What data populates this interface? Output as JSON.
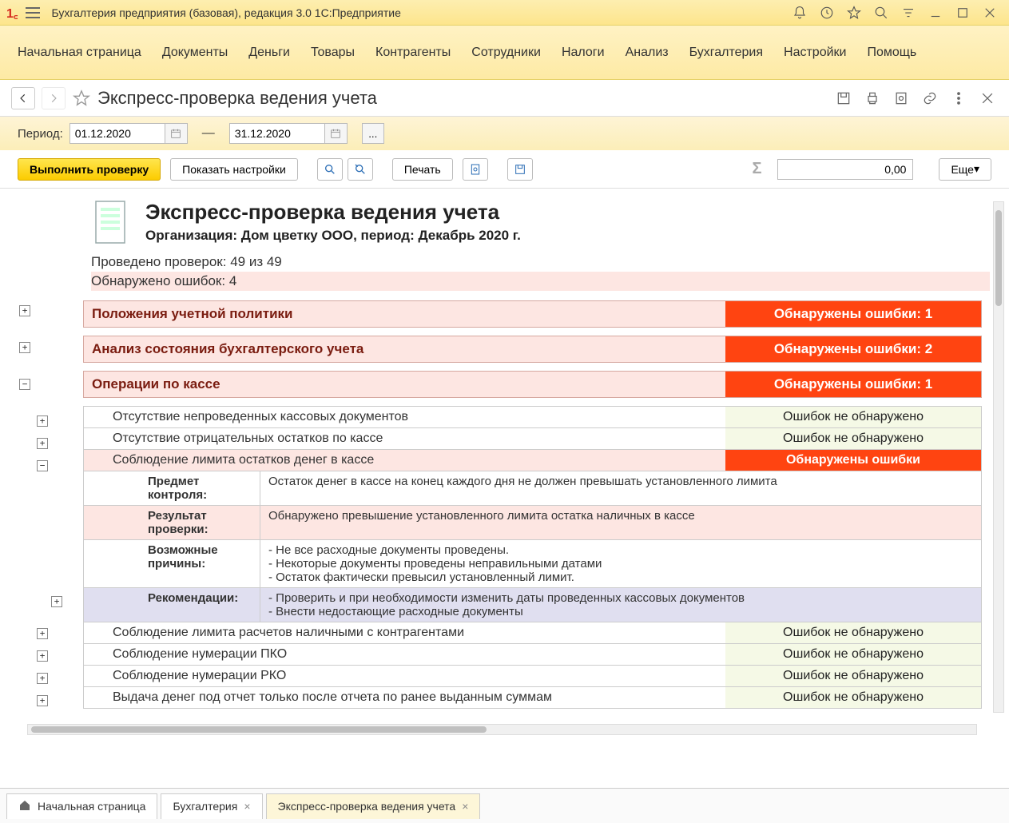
{
  "titlebar": {
    "app_title": "Бухгалтерия предприятия (базовая), редакция 3.0 1С:Предприятие"
  },
  "main_menu": [
    "Начальная страница",
    "Документы",
    "Деньги",
    "Товары",
    "Контрагенты",
    "Сотрудники",
    "Налоги",
    "Анализ",
    "Бухгалтерия",
    "Настройки",
    "Помощь"
  ],
  "page_header": {
    "title": "Экспресс-проверка ведения учета"
  },
  "period": {
    "label": "Период:",
    "from": "01.12.2020",
    "to": "31.12.2020",
    "dots": "..."
  },
  "toolbar": {
    "run": "Выполнить проверку",
    "show_settings": "Показать настройки",
    "print": "Печать",
    "total": "0,00",
    "more": "Еще"
  },
  "report": {
    "title": "Экспресс-проверка ведения учета",
    "subtitle": "Организация: Дом цветку ООО, период: Декабрь 2020 г.",
    "checks_done": "Проведено проверок: 49 из 49",
    "errors_found": "Обнаружено ошибок: 4"
  },
  "sections": [
    {
      "name": "Положения учетной политики",
      "status": "Обнаружены ошибки: 1"
    },
    {
      "name": "Анализ состояния бухгалтерского учета",
      "status": "Обнаружены ошибки: 2"
    },
    {
      "name": "Операции по кассе",
      "status": "Обнаружены ошибки: 1"
    }
  ],
  "checks": {
    "c1": {
      "name": "Отсутствие непроведенных кассовых документов",
      "status": "Ошибок не обнаружено"
    },
    "c2": {
      "name": "Отсутствие отрицательных остатков по кассе",
      "status": "Ошибок не обнаружено"
    },
    "c3": {
      "name": "Соблюдение лимита остатков денег в кассе",
      "status": "Обнаружены ошибки"
    },
    "c4": {
      "name": "Соблюдение лимита расчетов наличными с контрагентами",
      "status": "Ошибок не обнаружено"
    },
    "c5": {
      "name": "Соблюдение нумерации ПКО",
      "status": "Ошибок не обнаружено"
    },
    "c6": {
      "name": "Соблюдение нумерации РКО",
      "status": "Ошибок не обнаружено"
    },
    "c7": {
      "name": "Выдача денег под отчет только после отчета по ранее выданным суммам",
      "status": "Ошибок не обнаружено"
    }
  },
  "detail": {
    "subject_label": "Предмет контроля:",
    "subject_value": "Остаток денег в кассе на конец каждого дня не должен превышать установленного лимита",
    "result_label": "Результат проверки:",
    "result_value": "Обнаружено превышение установленного лимита остатка наличных в кассе",
    "causes_label": "Возможные причины:",
    "causes_value": "- Не все расходные документы проведены.\n- Некоторые документы проведены неправильными датами\n- Остаток фактически превысил установленный лимит.",
    "rec_label": "Рекомендации:",
    "rec_value": "- Проверить и при необходимости изменить даты проведенных кассовых документов\n- Внести недостающие расходные документы"
  },
  "tabs": {
    "home": "Начальная страница",
    "t1": "Бухгалтерия",
    "t2": "Экспресс-проверка ведения учета"
  }
}
